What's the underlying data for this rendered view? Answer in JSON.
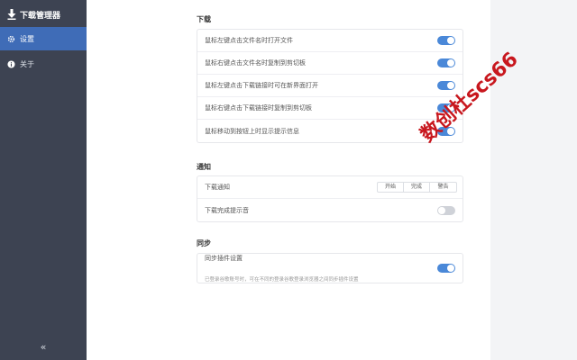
{
  "sidebar": {
    "app_title": "下载管理器",
    "items": [
      {
        "label": "设置",
        "icon": "gear-icon",
        "active": true
      },
      {
        "label": "关于",
        "icon": "info-icon",
        "active": false
      }
    ],
    "collapse_label": "«"
  },
  "sections": {
    "download": {
      "title": "下载",
      "rows": [
        {
          "label": "鼠标左键点击文件名时打开文件",
          "on": true
        },
        {
          "label": "鼠标右键点击文件名时复制到剪切板",
          "on": true
        },
        {
          "label": "鼠标左键点击下载链接时可在新界面打开",
          "on": true
        },
        {
          "label": "鼠标右键点击下载链接时复制到剪切板",
          "on": true
        },
        {
          "label": "鼠标移动到按钮上时显示提示信息",
          "on": true
        }
      ]
    },
    "notify": {
      "title": "通知",
      "download_notify_label": "下载通知",
      "options": [
        "开始",
        "完成",
        "警告"
      ],
      "complete_sound_label": "下载完成提示音",
      "complete_sound_on": false
    },
    "sync": {
      "title": "同步",
      "row_label": "同步插件设置",
      "row_desc": "已登录谷歌账号时，可在不同的登录谷歌登录浏览器之间同步插件设置",
      "on": true
    }
  },
  "watermark": "数创杜scs66",
  "colors": {
    "sidebar_bg": "#3d4352",
    "active_item": "#3f6cb7",
    "toggle_on": "#4a88d8",
    "toggle_off": "#cfd2d8",
    "watermark": "#c8171e"
  }
}
